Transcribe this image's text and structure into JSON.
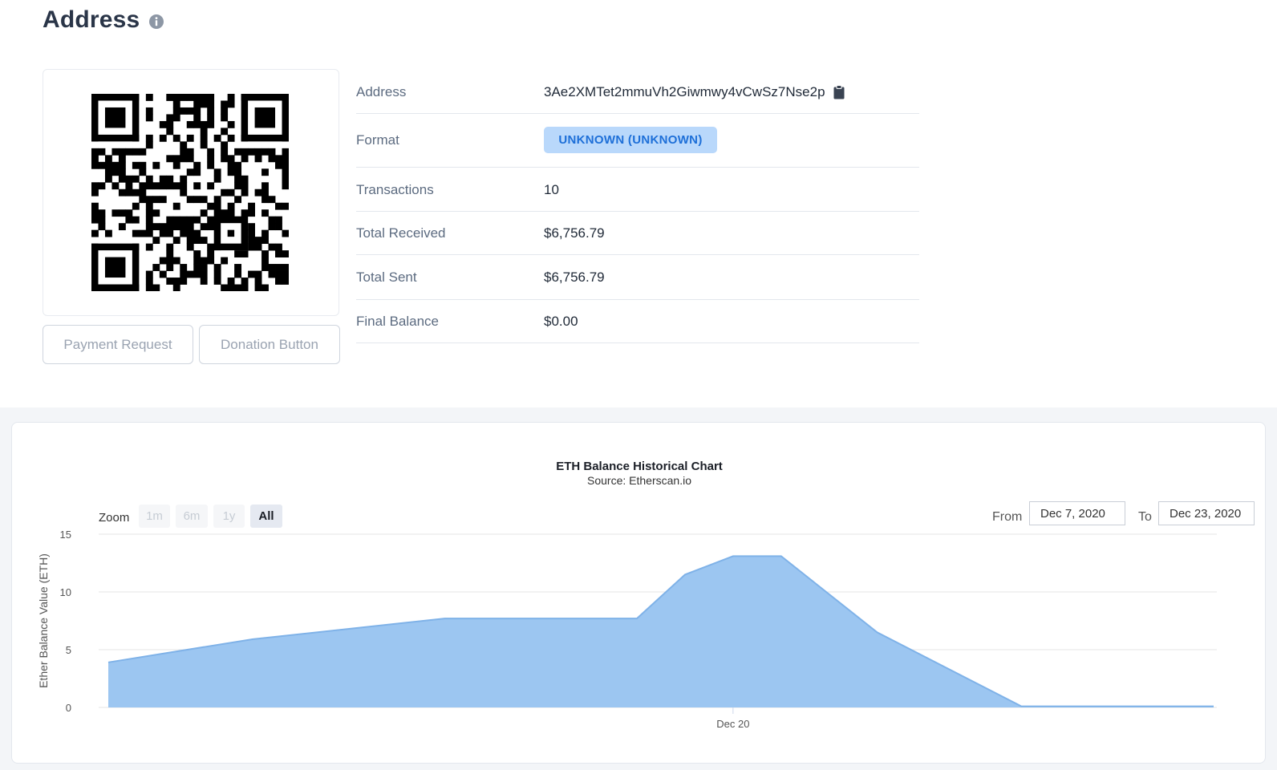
{
  "header": {
    "title": "Address"
  },
  "icons": {
    "info": "info-circle-icon",
    "copy": "clipboard-icon",
    "qr": "qr-code"
  },
  "buttons": {
    "payment_request": "Payment Request",
    "donation_button": "Donation Button"
  },
  "details": {
    "address_label": "Address",
    "address_value": "3Ae2XMTet2mmuVh2Giwmwy4vCwSz7Nse2p",
    "format_label": "Format",
    "format_value": "UNKNOWN (UNKNOWN)",
    "transactions_label": "Transactions",
    "transactions_value": "10",
    "total_received_label": "Total Received",
    "total_received_value": "$6,756.79",
    "total_sent_label": "Total Sent",
    "total_sent_value": "$6,756.79",
    "final_balance_label": "Final Balance",
    "final_balance_value": "$0.00"
  },
  "colors": {
    "badge_bg": "#b9d8fb",
    "badge_text": "#1d6fd8",
    "area_fill": "#9cc6f1",
    "area_line": "#7fb2e8"
  },
  "chart_controls": {
    "zoom_label": "Zoom",
    "zoom_options": [
      "1m",
      "6m",
      "1y",
      "All"
    ],
    "zoom_selected": "All",
    "from_label": "From",
    "from_value": "Dec 7, 2020",
    "to_label": "To",
    "to_value": "Dec 23, 2020"
  },
  "chart_data": {
    "type": "area",
    "title": "ETH Balance Historical Chart",
    "subtitle": "Source: Etherscan.io",
    "xlabel": "",
    "ylabel": "Ether Balance Value (ETH)",
    "x": [
      "2020-12-07",
      "2020-12-10",
      "2020-12-14",
      "2020-12-18",
      "2020-12-19",
      "2020-12-20",
      "2020-12-21",
      "2020-12-23",
      "2020-12-26",
      "2020-12-27",
      "2020-12-30"
    ],
    "values": [
      3.9,
      5.9,
      7.7,
      7.7,
      11.5,
      13.1,
      13.1,
      6.5,
      0.1,
      0.1,
      0.1
    ],
    "x_ticks": [
      "Dec 20"
    ],
    "y_ticks": [
      0,
      5,
      10,
      15
    ],
    "ylim": [
      0,
      15
    ],
    "grid": true,
    "legend": "none"
  }
}
